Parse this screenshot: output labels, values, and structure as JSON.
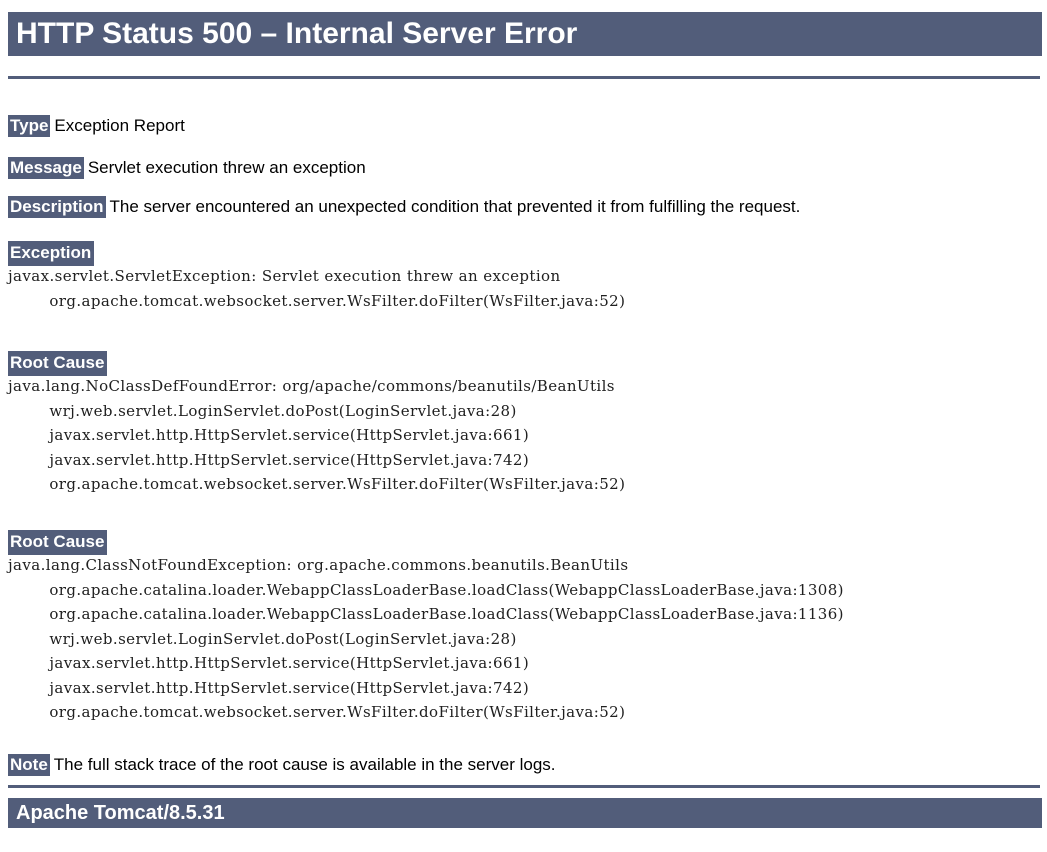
{
  "page": {
    "title": "HTTP Status 500 – Internal Server Error",
    "accent_color": "#525D7A",
    "text_color": "#000000",
    "background_color": "#ffffff"
  },
  "fields": {
    "type": {
      "label": "Type",
      "value": "Exception Report"
    },
    "message": {
      "label": "Message",
      "value": "Servlet execution threw an exception"
    },
    "description": {
      "label": "Description",
      "value": "The server encountered an unexpected condition that prevented it from fulfilling the request."
    },
    "note": {
      "label": "Note",
      "value": "The full stack trace of the root cause is available in the server logs."
    }
  },
  "sections": {
    "exception": {
      "heading": "Exception",
      "trace": "javax.servlet.ServletException: Servlet execution threw an exception\n\torg.apache.tomcat.websocket.server.WsFilter.doFilter(WsFilter.java:52)"
    },
    "root_cause_1": {
      "heading": "Root Cause",
      "trace": "java.lang.NoClassDefFoundError: org/apache/commons/beanutils/BeanUtils\n\twrj.web.servlet.LoginServlet.doPost(LoginServlet.java:28)\n\tjavax.servlet.http.HttpServlet.service(HttpServlet.java:661)\n\tjavax.servlet.http.HttpServlet.service(HttpServlet.java:742)\n\torg.apache.tomcat.websocket.server.WsFilter.doFilter(WsFilter.java:52)"
    },
    "root_cause_2": {
      "heading": "Root Cause",
      "trace": "java.lang.ClassNotFoundException: org.apache.commons.beanutils.BeanUtils\n\torg.apache.catalina.loader.WebappClassLoaderBase.loadClass(WebappClassLoaderBase.java:1308)\n\torg.apache.catalina.loader.WebappClassLoaderBase.loadClass(WebappClassLoaderBase.java:1136)\n\twrj.web.servlet.LoginServlet.doPost(LoginServlet.java:28)\n\tjavax.servlet.http.HttpServlet.service(HttpServlet.java:661)\n\tjavax.servlet.http.HttpServlet.service(HttpServlet.java:742)\n\torg.apache.tomcat.websocket.server.WsFilter.doFilter(WsFilter.java:52)"
    }
  },
  "footer": {
    "server": "Apache Tomcat/8.5.31"
  }
}
